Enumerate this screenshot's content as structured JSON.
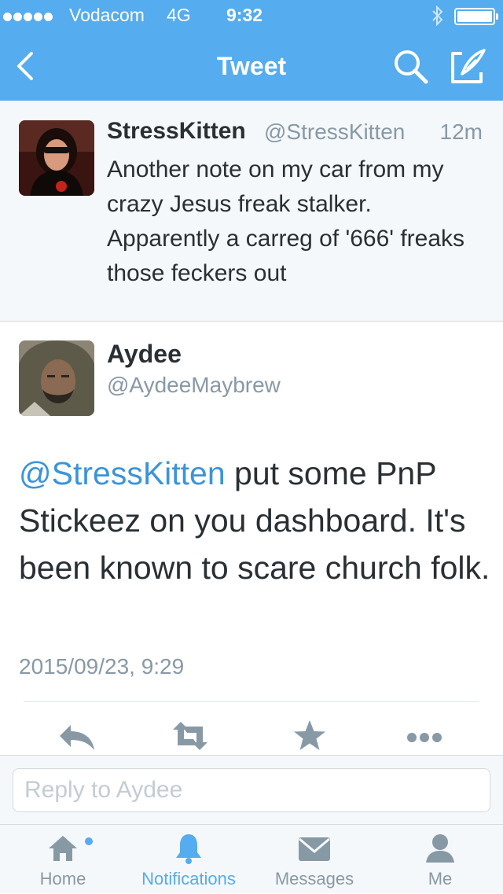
{
  "status_bar": {
    "carrier": "Vodacom",
    "network": "4G",
    "time": "9:32"
  },
  "nav": {
    "title": "Tweet",
    "back_icon": "chevron-left-icon",
    "search_icon": "search-icon",
    "compose_icon": "compose-icon"
  },
  "original_tweet": {
    "name": "StressKitten",
    "handle": "@StressKitten",
    "time": "12m",
    "text": "Another note on my car from my crazy Jesus freak stalker. Apparently a carreg of '666' freaks those feckers out"
  },
  "reply_tweet": {
    "name": "Aydee",
    "handle": "@AydeeMaybrew",
    "mention": "@StressKitten",
    "text": " put some PnP Stickeez on you dashboard. It's been known to scare church folk.",
    "date": "2015/09/23, 9:29"
  },
  "actions": [
    "reply-icon",
    "retweet-icon",
    "favorite-icon",
    "more-icon"
  ],
  "reply_box": {
    "placeholder": "Reply to Aydee"
  },
  "tabs": [
    {
      "label": "Home",
      "icon": "home-icon"
    },
    {
      "label": "Notifications",
      "icon": "bell-icon"
    },
    {
      "label": "Messages",
      "icon": "envelope-icon"
    },
    {
      "label": "Me",
      "icon": "person-icon"
    }
  ],
  "colors": {
    "accent": "#55acee",
    "link": "#3b94d9",
    "secondary_text": "#8899a6",
    "action_icon": "#8899a6"
  }
}
